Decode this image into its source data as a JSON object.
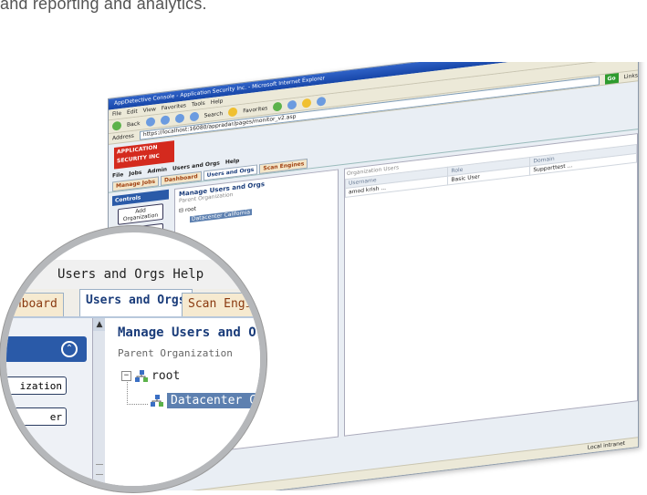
{
  "caption": "and reporting and analytics.",
  "browser": {
    "title": "AppDetective Console - Application Security Inc. - Microsoft Internet Explorer",
    "menu": [
      "File",
      "Edit",
      "View",
      "Favorites",
      "Tools",
      "Help"
    ],
    "toolbar": {
      "back": "Back",
      "search": "Search",
      "favorites": "Favorites"
    },
    "address_label": "Address",
    "address": "https://localhost:16080/appradar/pages/monitor_v2.asp",
    "go": "Go",
    "links": "Links",
    "status_zone": "Local intranet"
  },
  "app": {
    "brand_line1": "APPLICATION",
    "brand_line2": "SECURITY INC",
    "menu": [
      "File",
      "Jobs",
      "Admin",
      "Users and Orgs",
      "Help"
    ],
    "tabs": [
      "Manage Jobs",
      "Dashboard",
      "Users and Orgs",
      "Scan Engines"
    ],
    "active_tab": "Users and Orgs",
    "controls_title": "Controls",
    "controls_buttons": [
      "Add Organization",
      "Add User"
    ],
    "page_title": "Manage Users and Orgs",
    "parent_org_label": "Parent Organization",
    "tree": {
      "root": "root",
      "child": "Datacenter California"
    },
    "org_users_label": "Organization Users",
    "users_columns": [
      "Username",
      "Role",
      "Domain"
    ],
    "users_rows": [
      {
        "username": "amod krish ...",
        "role": "Basic User",
        "domain": "Supporttest ..."
      }
    ]
  },
  "zoom": {
    "menu_text": "Users and Orgs   Help",
    "tabs": [
      "shboard",
      "Users and Orgs",
      "Scan Engines"
    ],
    "collapse_glyph": "⌃",
    "btn1": "ization",
    "btn2": "er",
    "title": "Manage Users and Orgs",
    "parent_org": "Parent Organization",
    "root": "root",
    "child": "Datacenter Califo"
  }
}
